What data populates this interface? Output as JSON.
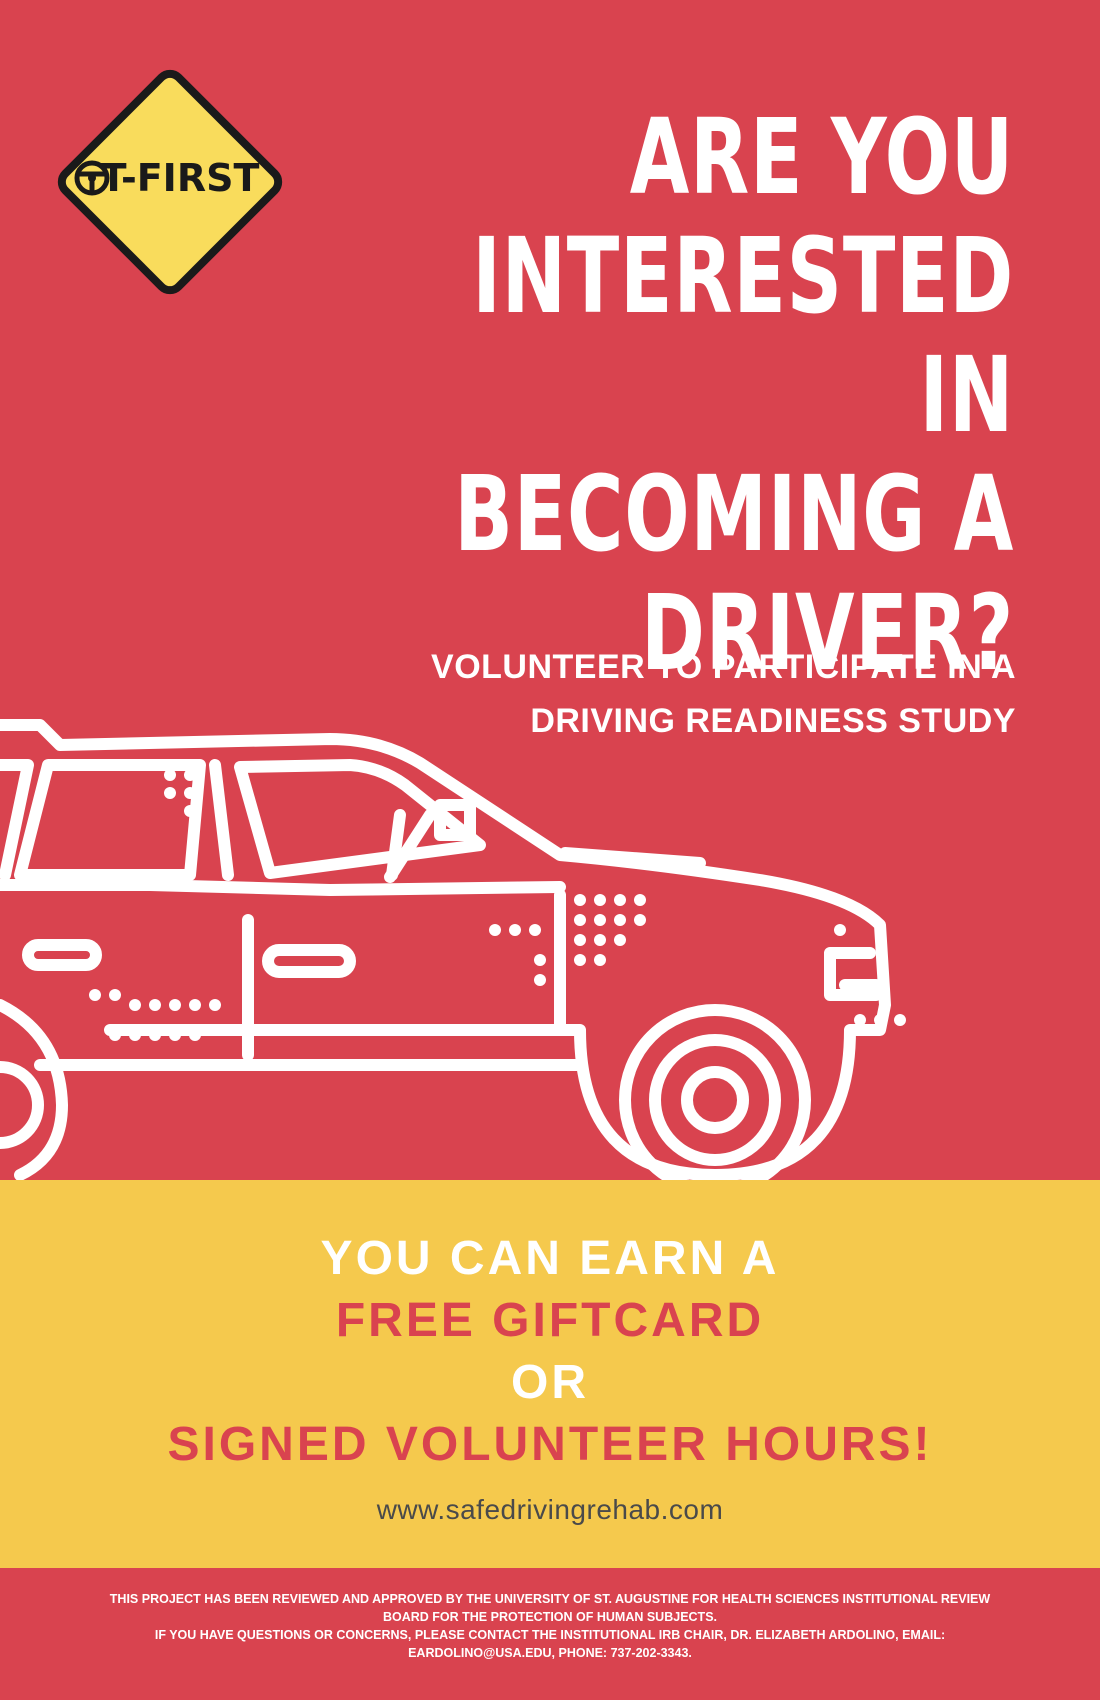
{
  "logo": {
    "text": "T-FIRST",
    "icon": "steering-wheel-icon",
    "sign_color": "#f9dc5c",
    "border_color": "#1a1a1a"
  },
  "headline": {
    "lines": [
      "ARE YOU",
      "INTERESTED IN",
      "BECOMING A",
      "DRIVER?"
    ]
  },
  "subheadline": {
    "lines": [
      "VOLUNTEER TO PARTICIPATE IN A",
      "DRIVING READINESS STUDY"
    ]
  },
  "offer": {
    "line1": "YOU CAN EARN A",
    "line2": "FREE GIFTCARD",
    "line3": "OR",
    "line4": "SIGNED VOLUNTEER HOURS!",
    "website": "www.safedrivingrehab.com"
  },
  "footer": {
    "lines": [
      "THIS PROJECT HAS BEEN REVIEWED AND APPROVED BY THE UNIVERSITY OF ST. AUGUSTINE FOR HEALTH SCIENCES INSTITUTIONAL REVIEW",
      "BOARD FOR THE PROTECTION OF HUMAN SUBJECTS.",
      "IF YOU HAVE QUESTIONS OR CONCERNS, PLEASE CONTACT THE INSTITUTIONAL IRB CHAIR, DR. ELIZABETH ARDOLINO, EMAIL:",
      "EARDOLINO@USA.EDU, PHONE: 737-202-3343."
    ]
  },
  "colors": {
    "background": "#d9434f",
    "band": "#f5c94d",
    "text_white": "#ffffff",
    "text_red": "#d9434f",
    "website_text": "#4a4a4a"
  },
  "illustration": "car-outline-icon"
}
